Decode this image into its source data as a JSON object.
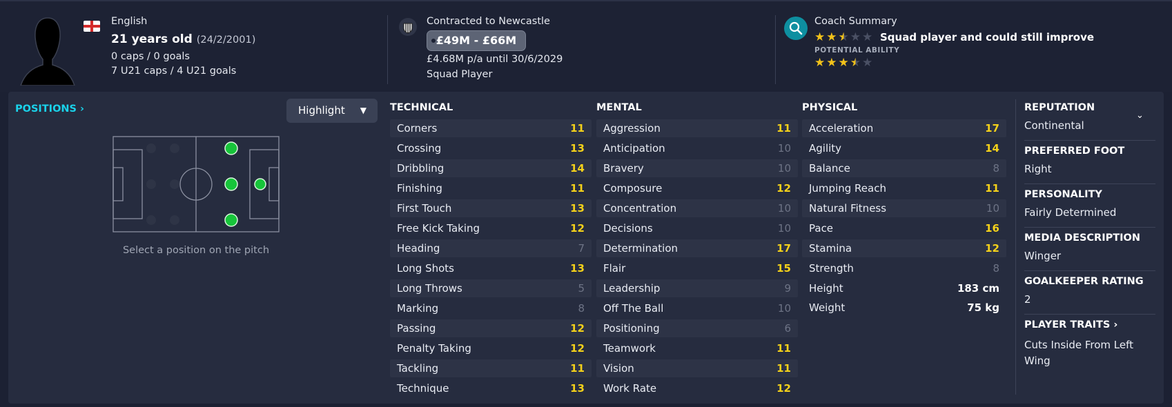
{
  "header": {
    "nationality": "English",
    "age_text": "21 years old",
    "dob_text": "(24/2/2001)",
    "caps_text": "0 caps / 0 goals",
    "u21_text": "7 U21 caps / 4 U21 goals",
    "contract_title": "Contracted to Newcastle",
    "value_range": "£49M - £66M",
    "wage_text": "£4.68M p/a until 30/6/2029",
    "squad_status": "Squad Player",
    "coach_title": "Coach Summary",
    "coach_summary": "Squad player and could still improve",
    "current_ability_stars": 2.5,
    "potential_label": "POTENTIAL ABILITY",
    "potential_ability_stars": 3.5
  },
  "positions": {
    "link_label": "POSITIONS",
    "dropdown_label": "Highlight",
    "caption": "Select a position on the pitch"
  },
  "technical": {
    "title": "TECHNICAL",
    "attrs": [
      {
        "name": "Corners",
        "value": "11"
      },
      {
        "name": "Crossing",
        "value": "13"
      },
      {
        "name": "Dribbling",
        "value": "14"
      },
      {
        "name": "Finishing",
        "value": "11"
      },
      {
        "name": "First Touch",
        "value": "13"
      },
      {
        "name": "Free Kick Taking",
        "value": "12"
      },
      {
        "name": "Heading",
        "value": "7"
      },
      {
        "name": "Long Shots",
        "value": "13"
      },
      {
        "name": "Long Throws",
        "value": "5"
      },
      {
        "name": "Marking",
        "value": "8"
      },
      {
        "name": "Passing",
        "value": "12"
      },
      {
        "name": "Penalty Taking",
        "value": "12"
      },
      {
        "name": "Tackling",
        "value": "11"
      },
      {
        "name": "Technique",
        "value": "13"
      }
    ]
  },
  "mental": {
    "title": "MENTAL",
    "attrs": [
      {
        "name": "Aggression",
        "value": "11"
      },
      {
        "name": "Anticipation",
        "value": "10"
      },
      {
        "name": "Bravery",
        "value": "10"
      },
      {
        "name": "Composure",
        "value": "12"
      },
      {
        "name": "Concentration",
        "value": "10"
      },
      {
        "name": "Decisions",
        "value": "10"
      },
      {
        "name": "Determination",
        "value": "17"
      },
      {
        "name": "Flair",
        "value": "15"
      },
      {
        "name": "Leadership",
        "value": "9"
      },
      {
        "name": "Off The Ball",
        "value": "10"
      },
      {
        "name": "Positioning",
        "value": "6"
      },
      {
        "name": "Teamwork",
        "value": "11"
      },
      {
        "name": "Vision",
        "value": "11"
      },
      {
        "name": "Work Rate",
        "value": "12"
      }
    ]
  },
  "physical": {
    "title": "PHYSICAL",
    "attrs": [
      {
        "name": "Acceleration",
        "value": "17"
      },
      {
        "name": "Agility",
        "value": "14"
      },
      {
        "name": "Balance",
        "value": "8"
      },
      {
        "name": "Jumping Reach",
        "value": "11"
      },
      {
        "name": "Natural Fitness",
        "value": "10"
      },
      {
        "name": "Pace",
        "value": "16"
      },
      {
        "name": "Stamina",
        "value": "12"
      },
      {
        "name": "Strength",
        "value": "8"
      }
    ],
    "height_label": "Height",
    "height_value": "183 cm",
    "weight_label": "Weight",
    "weight_value": "75 kg"
  },
  "sidebar": {
    "reputation_title": "REPUTATION",
    "reputation_value": "Continental",
    "foot_title": "PREFERRED FOOT",
    "foot_value": "Right",
    "personality_title": "PERSONALITY",
    "personality_value": "Fairly Determined",
    "media_title": "MEDIA DESCRIPTION",
    "media_value": "Winger",
    "gk_title": "GOALKEEPER RATING",
    "gk_value": "2",
    "traits_title": "PLAYER TRAITS",
    "traits_value_line1": "Cuts Inside From Left",
    "traits_value_line2": "Wing"
  },
  "colors": {
    "accent": "#1ad2ea",
    "high_value": "#f4d11a",
    "low_value": "#6d7385",
    "star": "#f2c21a",
    "position_dot": "#17c43a"
  }
}
